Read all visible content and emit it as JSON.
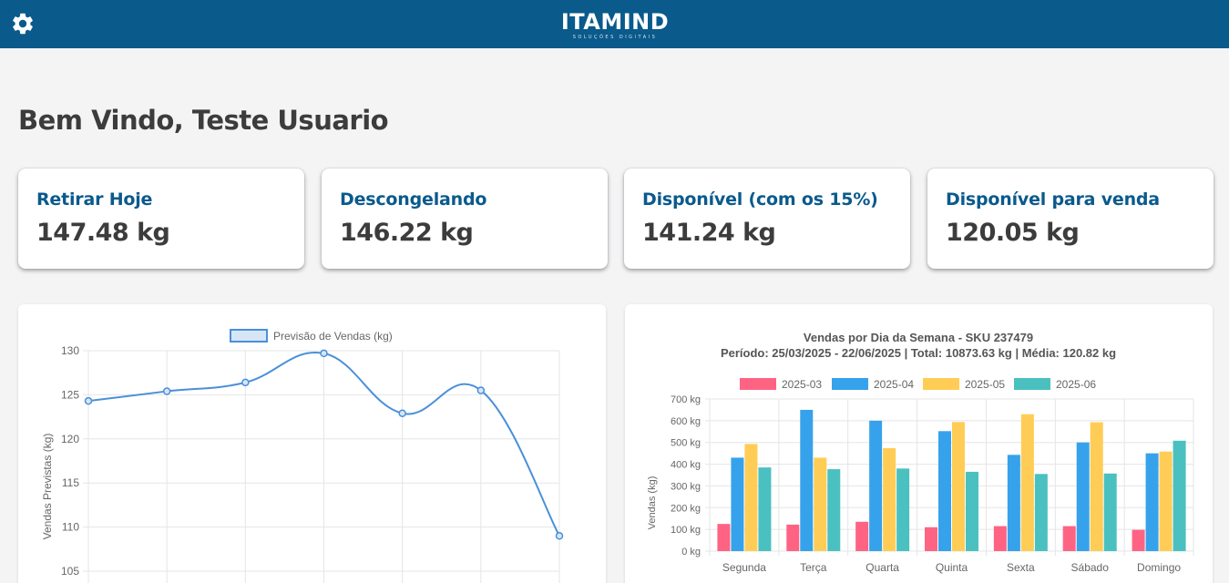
{
  "header": {
    "logo_text": "ITAMIND",
    "logo_subtitle": "SOLUÇÕES DIGITAIS",
    "settings_icon": "gear-icon",
    "background_color": "#0a5a8c"
  },
  "welcome": "Bem Vindo, Teste Usuario",
  "cards": [
    {
      "title": "Retirar Hoje",
      "value": "147.48 kg"
    },
    {
      "title": "Descongelando",
      "value": "146.22 kg"
    },
    {
      "title": "Disponível (com os 15%)",
      "value": "141.24 kg"
    },
    {
      "title": "Disponível para venda",
      "value": "120.05 kg"
    }
  ],
  "chart_data": [
    {
      "type": "line",
      "title": "",
      "legend": [
        "Previsão de Vendas (kg)"
      ],
      "legend_position": "top",
      "ylabel": "Vendas Previstas (kg)",
      "ylim": [
        105,
        130
      ],
      "yticks": [
        "130",
        "125",
        "120",
        "115",
        "110",
        "105"
      ],
      "grid": true,
      "color": "#4a90d9",
      "series": [
        {
          "name": "Previsão de Vendas (kg)",
          "values": [
            124.3,
            125.4,
            126.4,
            129.7,
            122.9,
            125.5,
            109.0
          ]
        }
      ]
    },
    {
      "type": "bar",
      "title": "Vendas por Dia da Semana - SKU 237479",
      "subtitle": "Período: 25/03/2025 - 22/06/2025 | Total: 10873.63 kg | Média: 120.82 kg",
      "ylabel": "Vendas (kg)",
      "ylim": [
        0,
        700
      ],
      "yticks": [
        "700 kg",
        "600 kg",
        "500 kg",
        "400 kg",
        "300 kg",
        "200 kg",
        "100 kg",
        "0 kg"
      ],
      "grid": true,
      "legend_position": "top",
      "categories": [
        "Segunda",
        "Terça",
        "Quarta",
        "Quinta",
        "Sexta",
        "Sábado",
        "Domingo"
      ],
      "series": [
        {
          "name": "2025-03",
          "color": "#ff6384",
          "values": [
            125,
            122,
            135,
            110,
            115,
            115,
            98
          ]
        },
        {
          "name": "2025-04",
          "color": "#36a2eb",
          "values": [
            430,
            650,
            600,
            552,
            443,
            500,
            450
          ]
        },
        {
          "name": "2025-05",
          "color": "#ffcd56",
          "values": [
            493,
            430,
            474,
            594,
            630,
            593,
            458
          ]
        },
        {
          "name": "2025-06",
          "color": "#4bc0c0",
          "values": [
            385,
            377,
            380,
            365,
            355,
            357,
            508
          ]
        }
      ]
    }
  ]
}
